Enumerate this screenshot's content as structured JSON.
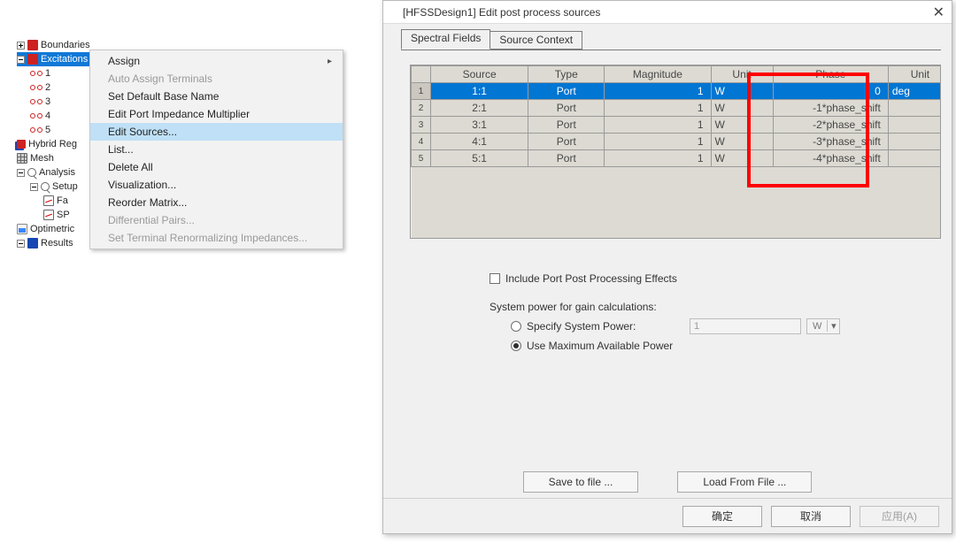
{
  "dialog": {
    "title": "[HFSSDesign1]  Edit post process sources",
    "tabs": {
      "spectral": "Spectral Fields",
      "context": "Source Context"
    },
    "table": {
      "headers": {
        "source": "Source",
        "type": "Type",
        "magnitude": "Magnitude",
        "unit": "Unit",
        "phase": "Phase",
        "unit2": "Unit"
      },
      "rows": [
        {
          "n": "1",
          "source": "1:1",
          "type": "Port",
          "mag": "1",
          "u": "W",
          "phase": "0",
          "u2": "deg"
        },
        {
          "n": "2",
          "source": "2:1",
          "type": "Port",
          "mag": "1",
          "u": "W",
          "phase": "-1*phase_shift",
          "u2": ""
        },
        {
          "n": "3",
          "source": "3:1",
          "type": "Port",
          "mag": "1",
          "u": "W",
          "phase": "-2*phase_shift",
          "u2": ""
        },
        {
          "n": "4",
          "source": "4:1",
          "type": "Port",
          "mag": "1",
          "u": "W",
          "phase": "-3*phase_shift",
          "u2": ""
        },
        {
          "n": "5",
          "source": "5:1",
          "type": "Port",
          "mag": "1",
          "u": "W",
          "phase": "-4*phase_shift",
          "u2": ""
        }
      ]
    },
    "include_effects": "Include Port Post Processing Effects",
    "system_power_label": "System power for gain calculations:",
    "specify": "Specify System Power:",
    "use_max": "Use Maximum Available Power",
    "specify_value": "1",
    "specify_unit": "W",
    "save": "Save to file ...",
    "load": "Load From File ...",
    "ok": "确定",
    "cancel": "取消",
    "apply": "应用(A)"
  },
  "ctx": {
    "assign": "Assign",
    "auto": "Auto Assign Terminals",
    "set_base": "Set Default Base Name",
    "edit_port_imp": "Edit Port Impedance Multiplier",
    "edit_sources": "Edit Sources...",
    "list": "List...",
    "delete_all": "Delete All",
    "viz": "Visualization...",
    "reorder": "Reorder Matrix...",
    "diff": "Differential Pairs...",
    "term_renorm": "Set Terminal Renormalizing Impedances..."
  },
  "tree": {
    "boundaries": "Boundaries",
    "excitations": "Excitations",
    "e1": "1",
    "e2": "2",
    "e3": "3",
    "e4": "4",
    "e5": "5",
    "hybrid": "Hybrid Reg",
    "mesh": "Mesh",
    "analysis": "Analysis",
    "setup": "Setup",
    "fa": "Fa",
    "sp": "SP",
    "opti": "Optimetric",
    "results": "Results"
  }
}
